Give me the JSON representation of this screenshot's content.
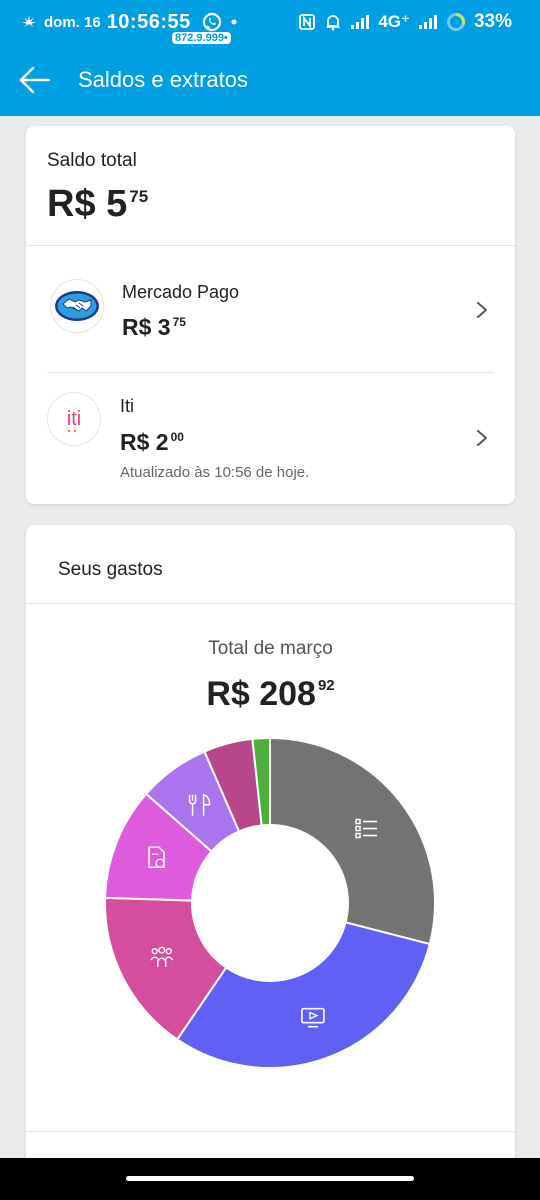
{
  "status_bar": {
    "date": "dom. 16",
    "time": "10:56:55",
    "number": "872.9.999•",
    "network": "4G⁺",
    "battery": "33%"
  },
  "app_bar": {
    "title": "Saldos e extratos"
  },
  "balance": {
    "label": "Saldo total",
    "amount_int": "R$ 5",
    "amount_cents": "75"
  },
  "accounts": [
    {
      "name": "Mercado Pago",
      "amount_int": "R$ 3",
      "amount_cents": "75",
      "icon": "mercado-pago-handshake-icon"
    },
    {
      "name": "Iti",
      "amount_int": "R$ 2",
      "amount_cents": "00",
      "logo_text": "iti",
      "updated": "Atualizado às 10:56 de hoje.",
      "icon": "iti-logo-icon"
    }
  ],
  "spending": {
    "title": "Seus gastos",
    "month_label": "Total de março",
    "amount_int": "R$ 208",
    "amount_cents": "92",
    "chart_data": {
      "type": "pie",
      "total": 208.92,
      "slices": [
        {
          "name": "list",
          "percent": 29.0,
          "color": "#737373",
          "icon": "list-icon"
        },
        {
          "name": "screen",
          "percent": 30.5,
          "color": "#6060f5",
          "icon": "tv-play-icon"
        },
        {
          "name": "people",
          "percent": 16.0,
          "color": "#d44e9d",
          "icon": "people-icon"
        },
        {
          "name": "document",
          "percent": 11.0,
          "color": "#dc5cdd",
          "icon": "document-money-icon"
        },
        {
          "name": "food",
          "percent": 7.0,
          "color": "#a974ee",
          "icon": "fork-knife-icon"
        },
        {
          "name": "magenta",
          "percent": 4.8,
          "color": "#b8468a",
          "icon": ""
        },
        {
          "name": "green",
          "percent": 1.7,
          "color": "#4cae3c",
          "icon": ""
        }
      ]
    }
  },
  "colors": {
    "brand_blue": "#009ee3",
    "iti_orange": "#f26b3a",
    "iti_pink": "#e8417a"
  }
}
